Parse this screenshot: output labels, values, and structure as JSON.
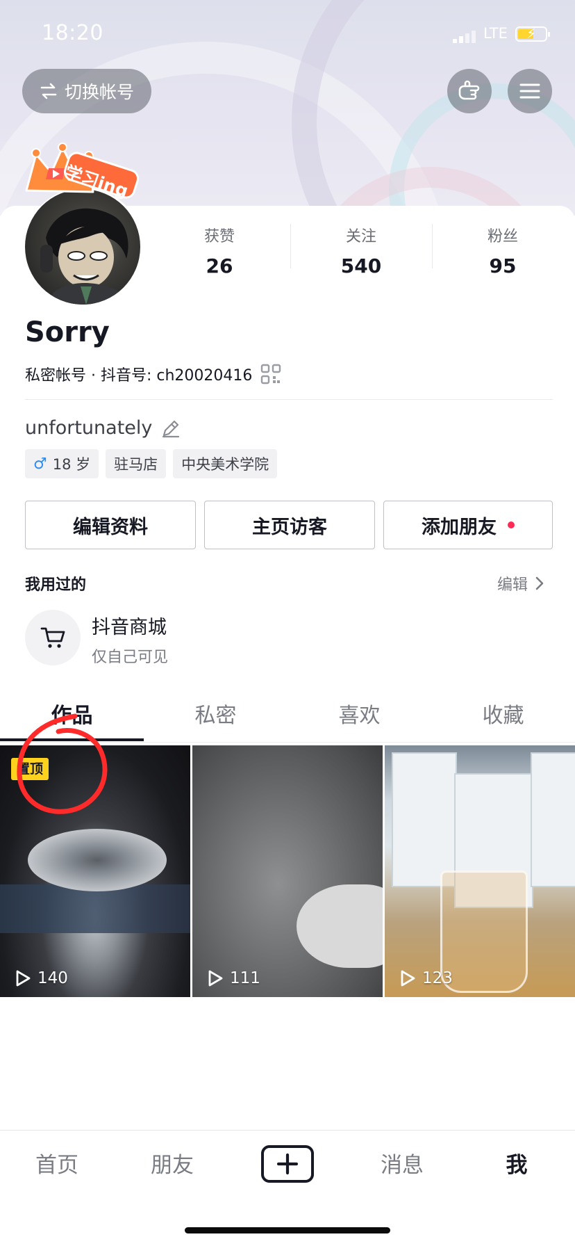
{
  "status_bar": {
    "time": "18:20",
    "network": "LTE"
  },
  "header": {
    "switch_account": "切换帐号"
  },
  "profile": {
    "avatar_badge": "学习ing",
    "stats": [
      {
        "label": "获赞",
        "value": "26"
      },
      {
        "label": "关注",
        "value": "540"
      },
      {
        "label": "粉丝",
        "value": "95"
      }
    ],
    "name": "Sorry",
    "id_line": "私密帐号 · 抖音号: ch20020416",
    "bio": "unfortunately",
    "tags": [
      "18 岁",
      "驻马店",
      "中央美术学院"
    ]
  },
  "actions": {
    "edit_profile": "编辑资料",
    "visitors": "主页访客",
    "add_friend": "添加朋友"
  },
  "used": {
    "title": "我用过的",
    "edit": "编辑",
    "item": {
      "name": "抖音商城",
      "sub": "仅自己可见"
    }
  },
  "tabs": [
    "作品",
    "私密",
    "喜欢",
    "收藏"
  ],
  "videos": [
    {
      "pinned_label": "置顶",
      "plays": "140"
    },
    {
      "plays": "111"
    },
    {
      "plays": "123"
    }
  ],
  "bottom_nav": {
    "home": "首页",
    "friends": "朋友",
    "messages": "消息",
    "me": "我"
  },
  "colors": {
    "accent_red": "#fe2c55",
    "pin_yellow": "#ffd21e",
    "text_primary": "#161823"
  },
  "icons": [
    "swap-icon",
    "hand-icon",
    "menu-icon",
    "qrcode-icon",
    "pencil-icon",
    "male-icon",
    "chevron-right-icon",
    "cart-icon",
    "play-icon",
    "plus-icon"
  ]
}
